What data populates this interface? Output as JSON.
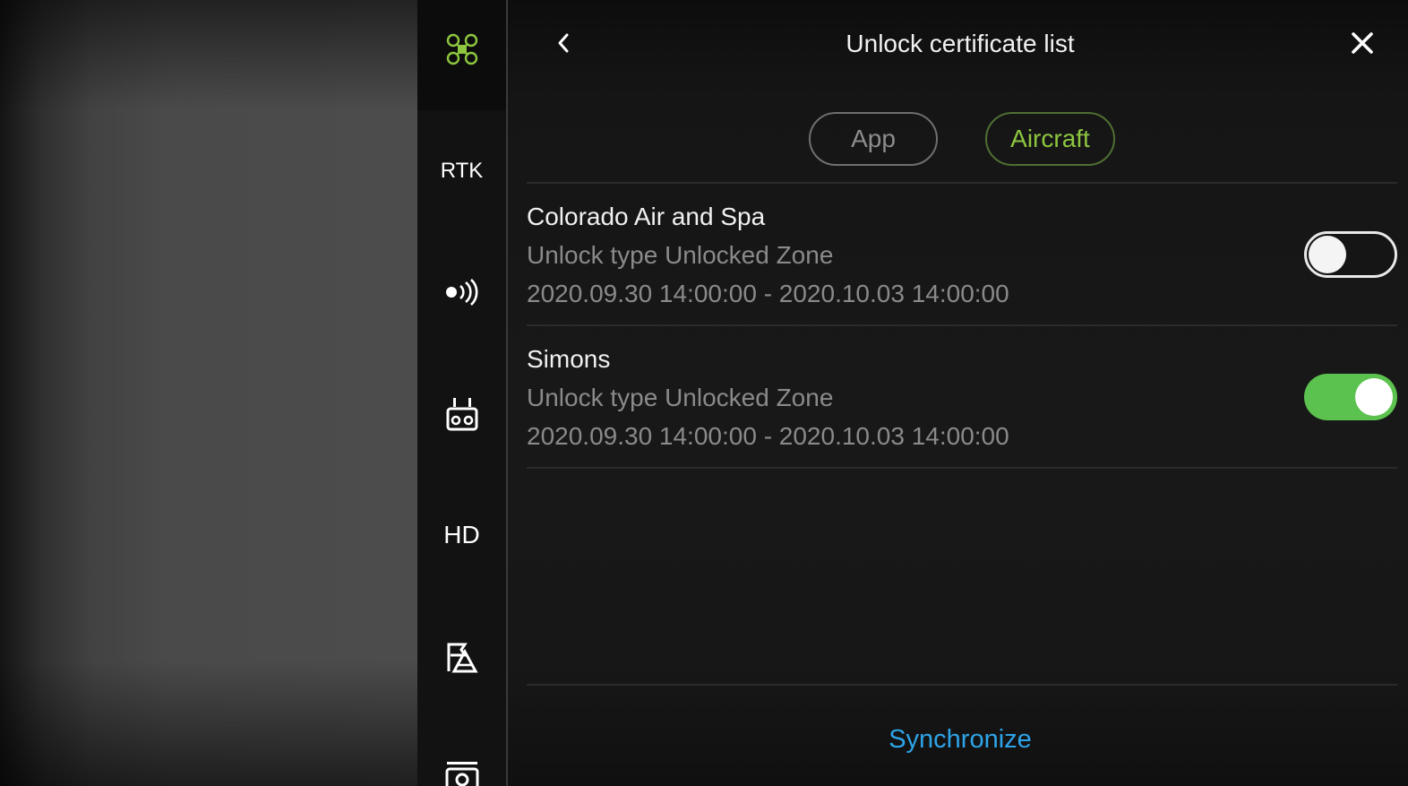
{
  "sidebar": {
    "items": [
      {
        "icon": "aircraft-icon"
      },
      {
        "label": "RTK"
      },
      {
        "icon": "signal-icon"
      },
      {
        "icon": "remote-controller-icon"
      },
      {
        "label": "HD"
      },
      {
        "icon": "map-flag-icon"
      },
      {
        "icon": "camera-icon"
      }
    ]
  },
  "header": {
    "title": "Unlock certificate list",
    "back_icon": "chevron-left-icon",
    "close_icon": "close-icon"
  },
  "tabs": [
    {
      "label": "App",
      "selected": false
    },
    {
      "label": "Aircraft",
      "selected": true
    }
  ],
  "certificates": [
    {
      "name": "Colorado Air and Spa",
      "unlock_type": "Unlock type Unlocked Zone",
      "validity": "2020.09.30 14:00:00 - 2020.10.03 14:00:00",
      "enabled": false
    },
    {
      "name": "Simons",
      "unlock_type": "Unlock type Unlocked Zone",
      "validity": "2020.09.30 14:00:00 - 2020.10.03 14:00:00",
      "enabled": true
    }
  ],
  "footer": {
    "sync_label": "Synchronize"
  },
  "colors": {
    "accent_green": "#8dc63f",
    "toggle_on": "#5cc24f",
    "link_blue": "#2ea4e8"
  }
}
